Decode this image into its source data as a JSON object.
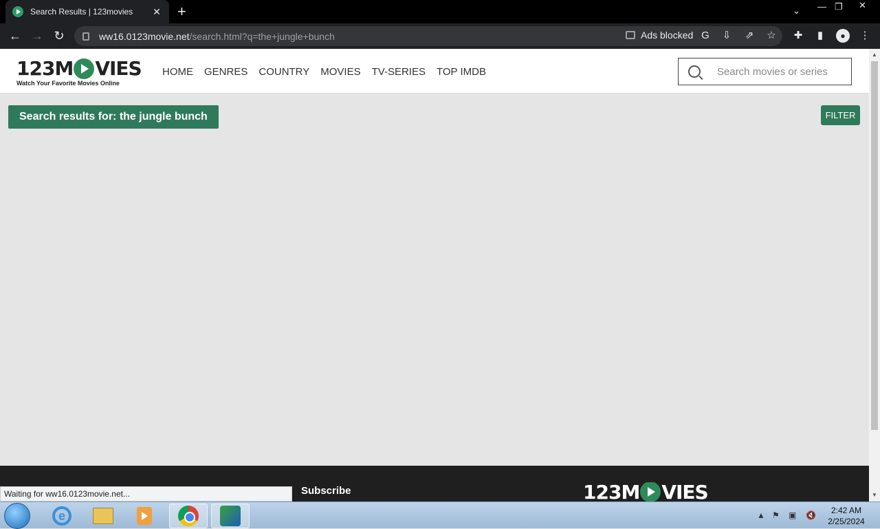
{
  "browser": {
    "tab_title": "Search Results | 123movies",
    "new_tab": "+",
    "url_host": "ww16.0123movie.net",
    "url_path": "/search.html?q=the+jungle+bunch",
    "ads_blocked": "Ads blocked"
  },
  "site": {
    "logo_left": "123M",
    "logo_right": "VIES",
    "logo_tagline": "Watch Your Favorite Movies Online",
    "nav": [
      "HOME",
      "GENRES",
      "COUNTRY",
      "MOVIES",
      "TV-SERIES",
      "TOP IMDB"
    ],
    "search_placeholder": "Search movies or series"
  },
  "content": {
    "results_title": "Search results for: the jungle bunch",
    "filter_label": "FILTER"
  },
  "footer": {
    "subscribe": "Subscribe",
    "logo_left": "123M",
    "logo_right": "VIES"
  },
  "status": "Waiting for ww16.0123movie.net...",
  "taskbar": {
    "time": "2:42 AM",
    "date": "2/25/2024"
  }
}
